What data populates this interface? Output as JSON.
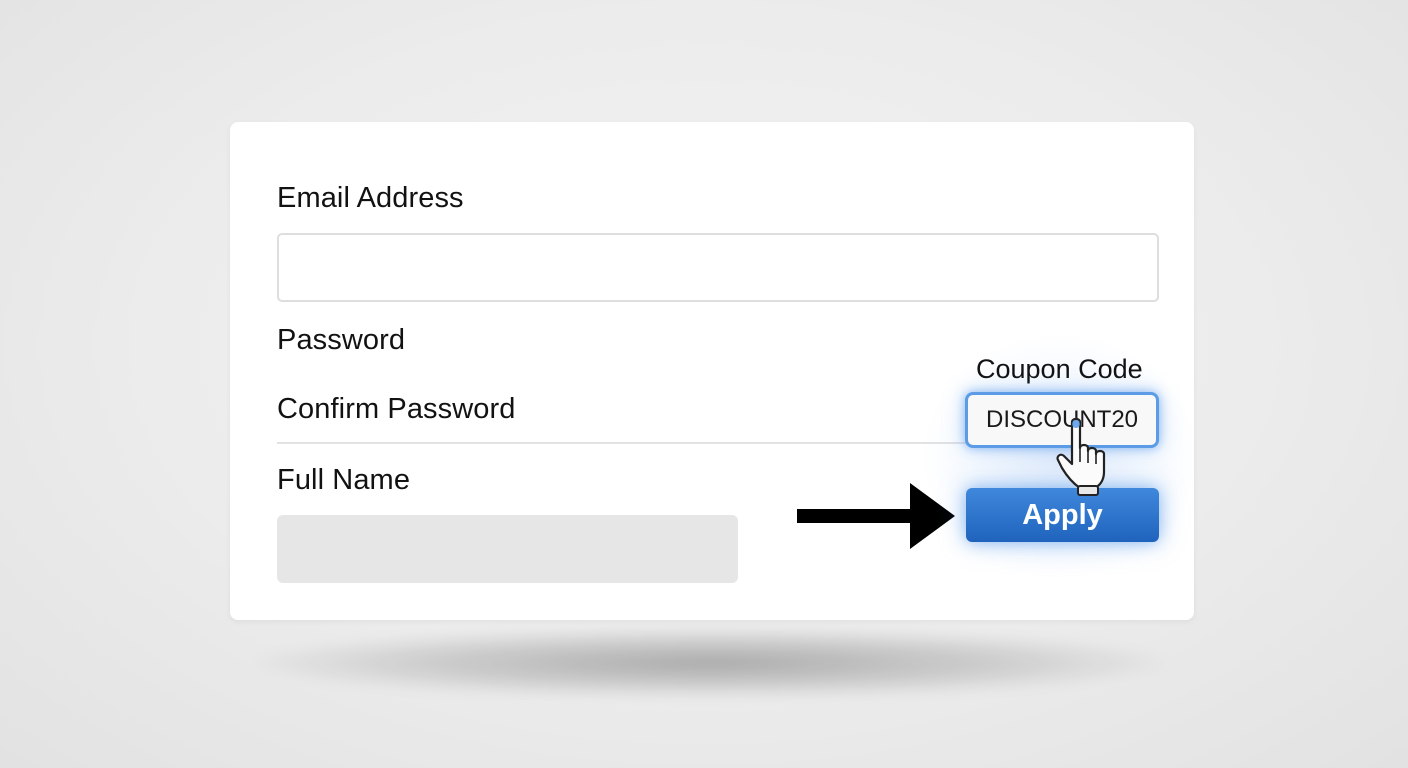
{
  "form": {
    "email_label": "Email Address",
    "email_value": "",
    "password_label": "Password",
    "confirm_password_label": "Confirm Password",
    "full_name_label": "Full Name",
    "full_name_value": "",
    "coupon": {
      "label": "Coupon Code",
      "value": "DISCOUNT20"
    },
    "apply_label": "Apply"
  },
  "colors": {
    "accent": "#2a72cc",
    "focus_ring": "#5c9be6",
    "background": "#ececec",
    "card": "#ffffff"
  },
  "icons": {
    "pointer": "hand-pointer-icon",
    "arrow": "right-arrow-icon"
  }
}
